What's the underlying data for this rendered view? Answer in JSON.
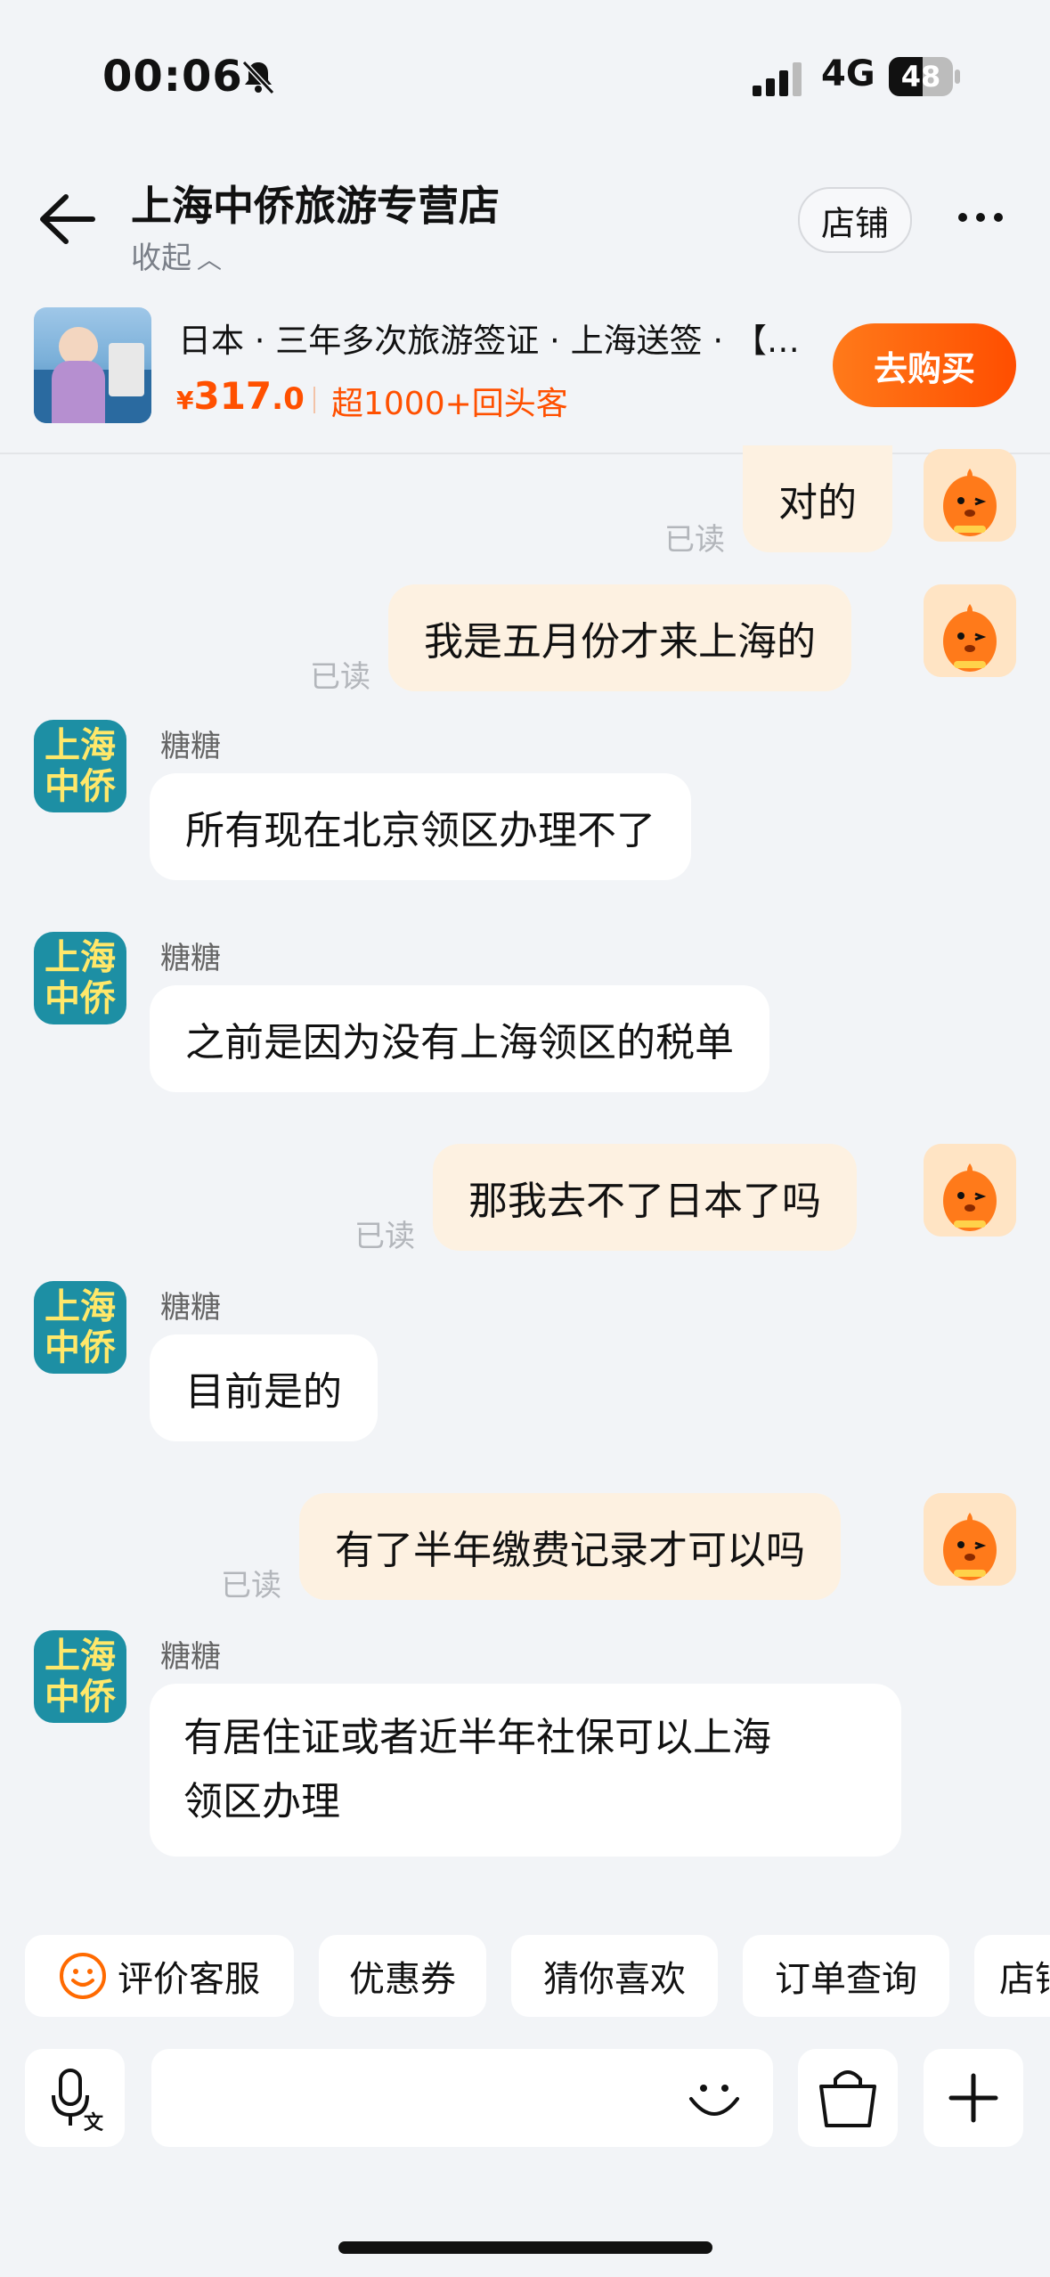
{
  "status_bar": {
    "time": "00:06",
    "network": "4G",
    "battery": "48"
  },
  "header": {
    "title": "上海中侨旅游专营店",
    "collapse_label": "收起",
    "store_button": "店铺"
  },
  "product": {
    "title": "日本 · 三年多次旅游签证 · 上海送签 · 【…",
    "currency": "¥",
    "price_int": "317",
    "price_dec": ".0",
    "tag": "超1000+回头客",
    "buy_label": "去购买"
  },
  "chat": {
    "read_label": "已读",
    "sender_name": "糖糖",
    "shop_avatar_text_line1": "上海",
    "shop_avatar_text_line2": "中侨",
    "messages": [
      {
        "from": "me",
        "text": "对的"
      },
      {
        "from": "me",
        "text": "我是五月份才来上海的"
      },
      {
        "from": "shop",
        "text": "所有现在北京领区办理不了"
      },
      {
        "from": "shop",
        "text": "之前是因为没有上海领区的税单"
      },
      {
        "from": "me",
        "text": "那我去不了日本了吗"
      },
      {
        "from": "shop",
        "text": "目前是的"
      },
      {
        "from": "me",
        "text": "有了半年缴费记录才可以吗"
      },
      {
        "from": "shop",
        "text_line1": "有居住证或者近半年社保可以上海",
        "text_line2": "领区办理"
      }
    ]
  },
  "quick_replies": [
    "评价客服",
    "优惠券",
    "猜你喜欢",
    "订单查询",
    "店铺"
  ],
  "colors": {
    "accent": "#ff5000",
    "my_bubble": "#fdf1e1",
    "shop_avatar_bg": "#1d8fa4",
    "shop_avatar_text": "#ffe86a"
  }
}
